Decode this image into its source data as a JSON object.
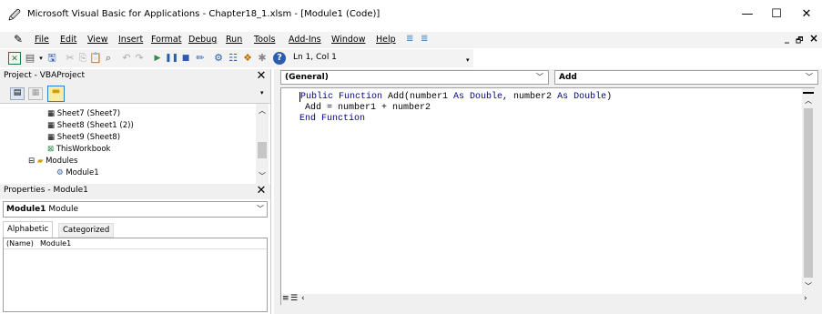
{
  "window": {
    "title": "Microsoft Visual Basic for Applications - Chapter18_1.xlsm - [Module1 (Code)]"
  },
  "window_controls": {
    "minimize": "—",
    "maximize": "☐",
    "close": "✕"
  },
  "mdi_controls": {
    "minimize": "_",
    "restore": "🗗",
    "close": "×"
  },
  "menu": [
    "File",
    "Edit",
    "View",
    "Insert",
    "Format",
    "Debug",
    "Run",
    "Tools",
    "Add-Ins",
    "Window",
    "Help"
  ],
  "toolbar": {
    "position": "Ln 1, Col 1"
  },
  "project_pane": {
    "title": "Project - VBAProject",
    "items": [
      "Sheet7 (Sheet7)",
      "Sheet8 (Sheet1 (2))",
      "Sheet9 (Sheet8)",
      "ThisWorkbook",
      "Modules",
      "Module1"
    ]
  },
  "properties_pane": {
    "title": "Properties - Module1",
    "object_name": "Module1",
    "object_type": "Module",
    "tabs": [
      "Alphabetic",
      "Categorized"
    ],
    "prop_name": "(Name)",
    "prop_value": "Module1"
  },
  "code_window": {
    "object_combo": "(General)",
    "proc_combo": "Add",
    "lines": [
      {
        "kw": "Public Function",
        "rest": " Add(number1 ",
        "kw2": "As Double",
        "rest2": ", number2 ",
        "kw3": "As Double",
        "rest3": ")"
      },
      {
        "plain": " Add = number1 + number2"
      },
      {
        "kw": "End Function"
      }
    ]
  },
  "colors": {
    "keyword": "#00008b",
    "chrome": "#f0f0f0",
    "accent": "#0078d7"
  }
}
